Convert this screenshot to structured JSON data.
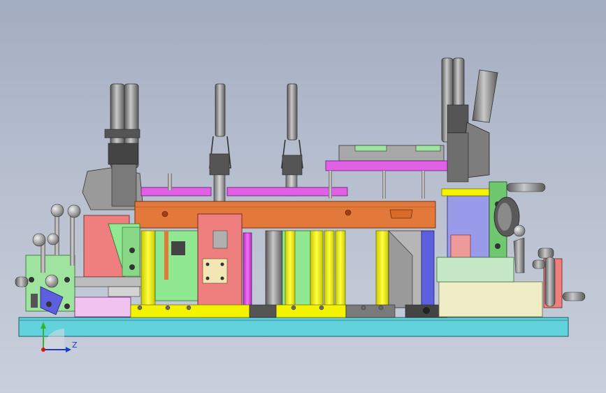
{
  "view": {
    "background_top": "#a4adc1",
    "background_bottom": "#c9cfdb"
  },
  "triad": {
    "z_label": "Z",
    "z_color": "#1a3cc8",
    "y_color": "#2eb82e",
    "origin_color": "#e01010"
  },
  "palette": {
    "base_plate": "#62d2dc",
    "orange_bar": "#e2793a",
    "magenta": "#e060e6",
    "yellow": "#f3f300",
    "red_block": "#ef7f7f",
    "green_block": "#90e890",
    "lavender": "#9a9aea",
    "cream": "#efedc6",
    "grey": "#8e8e8e",
    "dark": "#3a3a3a",
    "pink": "#f0c3f0",
    "blue": "#5e5ee0"
  }
}
